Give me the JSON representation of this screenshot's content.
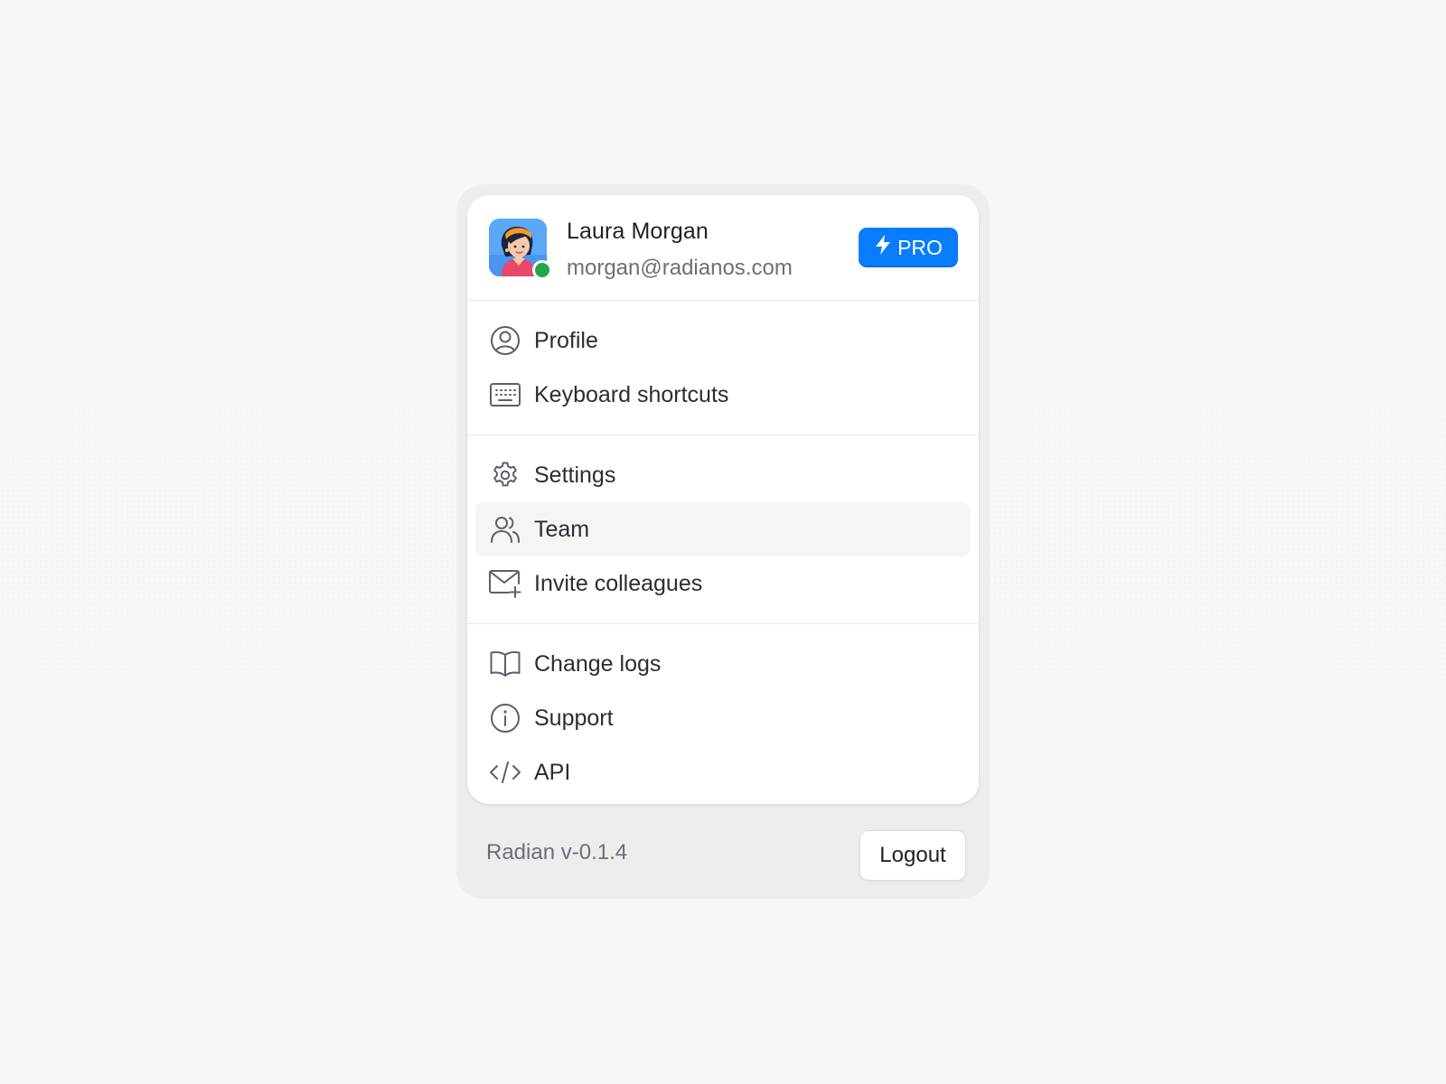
{
  "user": {
    "name": "Laura Morgan",
    "email": "morgan@radianos.com",
    "status": "online",
    "avatar_icon": "avatar-illustration",
    "badge_label": "PRO",
    "badge_icon": "lightning-icon"
  },
  "menu": {
    "sections": [
      [
        {
          "label": "Profile",
          "icon": "user-circle-icon"
        },
        {
          "label": "Keyboard shortcuts",
          "icon": "keyboard-icon"
        }
      ],
      [
        {
          "label": "Settings",
          "icon": "gear-icon"
        },
        {
          "label": "Team",
          "icon": "users-icon",
          "active": true
        },
        {
          "label": "Invite colleagues",
          "icon": "mail-plus-icon"
        }
      ],
      [
        {
          "label": "Change logs",
          "icon": "book-open-icon"
        },
        {
          "label": "Support",
          "icon": "info-icon"
        },
        {
          "label": "API",
          "icon": "code-icon"
        }
      ]
    ]
  },
  "footer": {
    "version": "Radian v-0.1.4",
    "logout_label": "Logout"
  },
  "colors": {
    "accent": "#0a7cff",
    "status_online": "#1ea84a",
    "active_row": "#f5f5f6"
  }
}
